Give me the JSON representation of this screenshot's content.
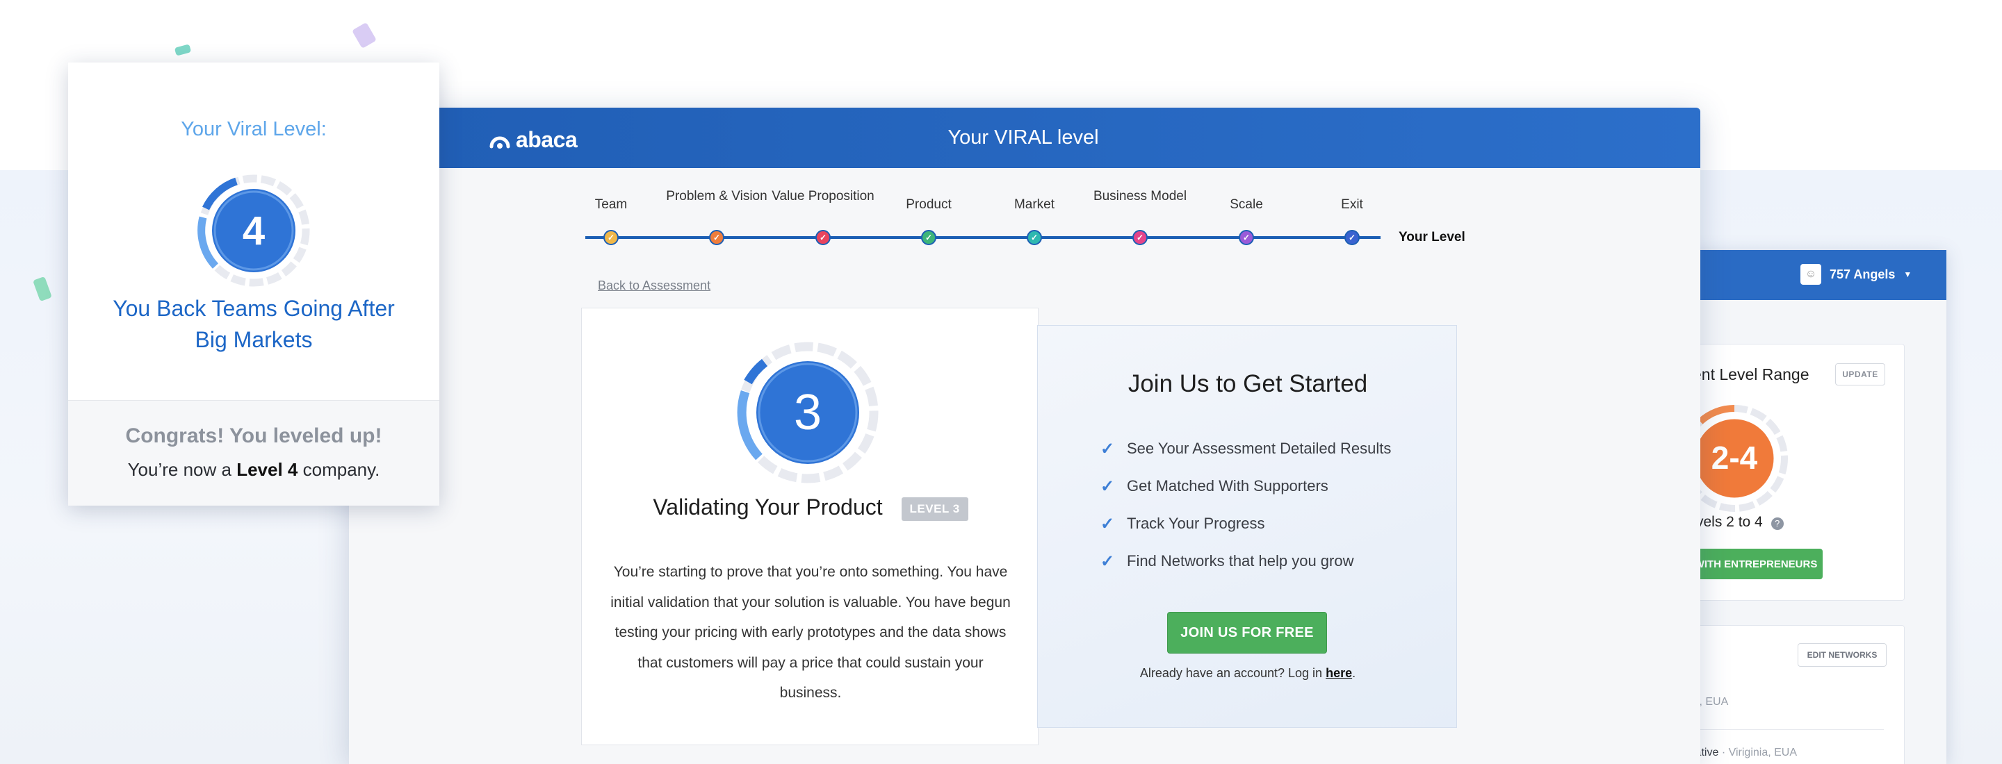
{
  "main_window": {
    "logo": "abaca",
    "header_title": "Your VIRAL level",
    "steps": [
      {
        "label": "Team",
        "color": "#f0b84a"
      },
      {
        "label": "Problem & Vision",
        "color": "#ef7d3c"
      },
      {
        "label": "Value Proposition",
        "color": "#e8445e"
      },
      {
        "label": "Product",
        "color": "#3db57a"
      },
      {
        "label": "Market",
        "color": "#2eb8b0"
      },
      {
        "label": "Business Model",
        "color": "#e6458a"
      },
      {
        "label": "Scale",
        "color": "#9a5ad8"
      },
      {
        "label": "Exit",
        "color": "#3a63d0"
      }
    ],
    "your_level_label": "Your Level",
    "back_link": "Back to Assessment",
    "level_card": {
      "level": "3",
      "title": "Validating Your Product",
      "badge": "LEVEL 3",
      "description": "You’re starting to prove that you’re onto something. You have initial validation that your solution is valuable. You have begun testing your pricing with early prototypes and the data shows that customers will pay a price that could sustain your business."
    },
    "join_panel": {
      "title": "Join Us to Get Started",
      "benefits": [
        "See Your Assessment Detailed Results",
        "Get Matched With Supporters",
        "Track Your Progress",
        "Find Networks that help you grow"
      ],
      "button": "JOIN US FOR FREE",
      "login_prefix": "Already have an account? Log in",
      "login_link": "here",
      "login_suffix": "."
    }
  },
  "popup": {
    "kicker": "Your Viral Level:",
    "level": "4",
    "title": "You Back Teams Going After Big Markets",
    "congrats": "Congrats! You leveled up!",
    "now_prefix": "You’re now a",
    "now_level": "Level 4",
    "now_suffix": "company."
  },
  "back_window": {
    "account_name": "757 Angels",
    "card_title": "ent Level Range",
    "update_button": "UPDATE",
    "range_value": "2-4",
    "range_text": "vels 2 to 4",
    "help_icon": "?",
    "green_button": "WITH ENTREPRENEURS",
    "edit_networks": "EDIT NETWORKS",
    "location_1": "ia, EUA",
    "location_2_name": "iative",
    "location_2_place": "Viriginia, EUA"
  },
  "colors": {
    "brand_blue": "#2a6bc4",
    "green": "#4caf5c",
    "level_blue": "#2f74d6",
    "range_orange": "#f07a3a"
  }
}
